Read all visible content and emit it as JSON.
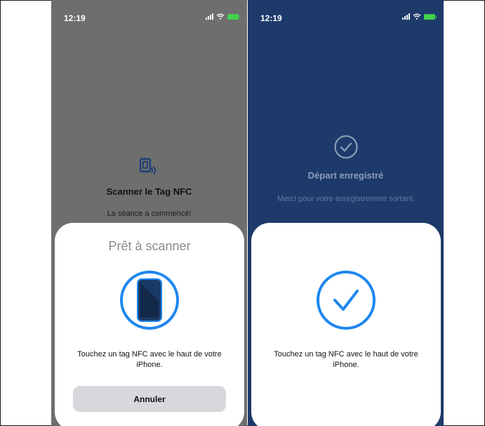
{
  "colors": {
    "left_background": "#6e6e6e",
    "right_background": "#1e3a6b",
    "accent_blue": "#1e87f0",
    "phone_icon_fill": "#1a3a66"
  },
  "left_screen": {
    "status_time": "12:19",
    "nfc_icon": "nfc-tag-icon",
    "title": "Scanner le Tag NFC",
    "subtitle": "La séance a commencé!",
    "sheet": {
      "title": "Prêt à scanner",
      "icon": "phone-scan-icon",
      "message": "Touchez un tag NFC avec le haut de votre iPhone.",
      "cancel_label": "Annuler"
    }
  },
  "right_screen": {
    "status_time": "12:19",
    "check_icon": "check-circle-icon",
    "title": "Départ enregistré",
    "subtitle": "Merci pour votre enregistrement sortant.",
    "sheet": {
      "icon": "check-circle-icon",
      "message": "Touchez un tag NFC avec le haut de votre iPhone."
    }
  }
}
